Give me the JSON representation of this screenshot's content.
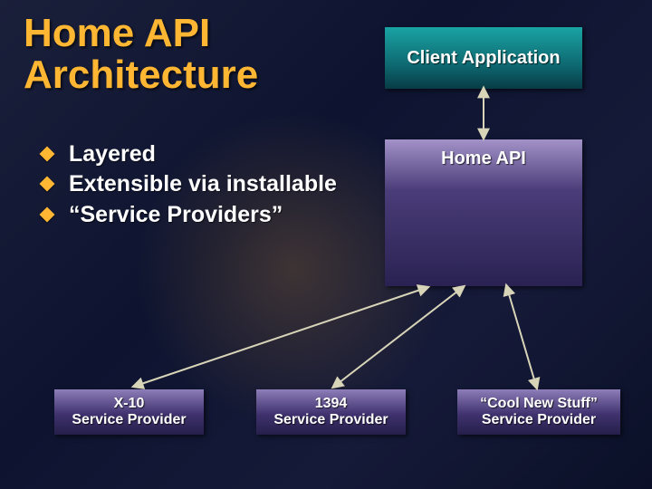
{
  "title": "Home API\nArchitecture",
  "bullets": [
    "Layered",
    "Extensible via installable",
    "“Service Providers”"
  ],
  "boxes": {
    "client_app": "Client Application",
    "home_api": "Home API",
    "sp_x10": "X-10\nService Provider",
    "sp_1394": "1394\nService Provider",
    "sp_cool": "“Cool New Stuff”\nService Provider"
  },
  "colors": {
    "accent": "#ffb733",
    "teal_top": "#1aa3a3",
    "purple_top": "#8d7db8"
  }
}
